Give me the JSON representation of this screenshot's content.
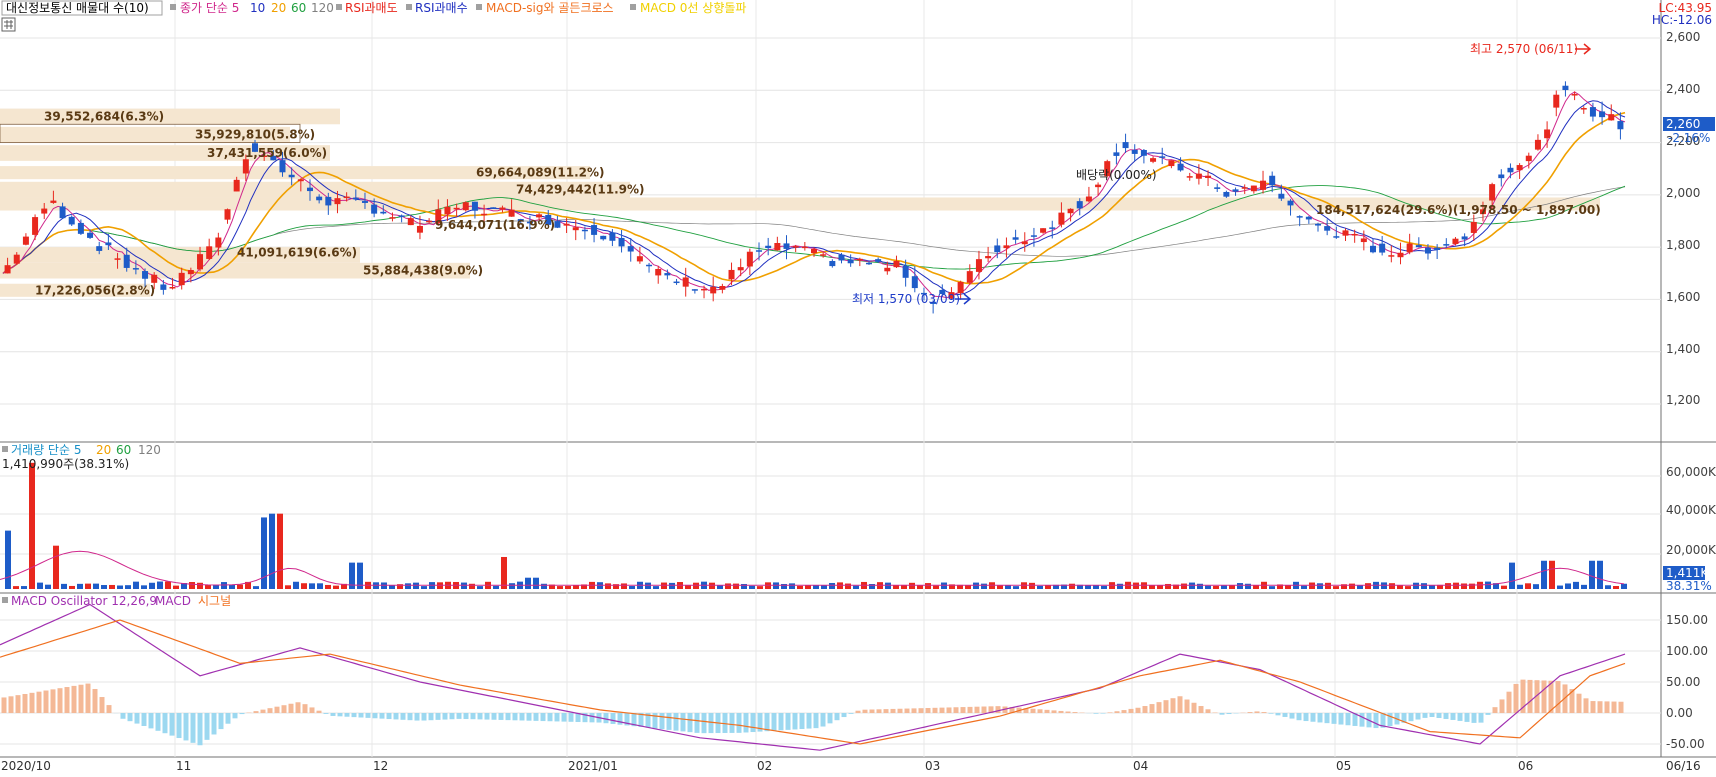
{
  "legend_top": {
    "title": "대신정보통신 매물대 수(10)",
    "ma_label": "종가 단순 5",
    "ma_periods": [
      "10",
      "20",
      "60",
      "120"
    ],
    "signals": [
      "RSI과매도",
      "RSI과매수",
      "MACD-sig와 골든크로스",
      "MACD 0선 상향돌파"
    ],
    "lc_value": "LC:43.95",
    "hc_value": "HC:-12.06"
  },
  "price_panel": {
    "y_ticks": [
      "2,600",
      "2,400",
      "2,200",
      "2,000",
      "1,800",
      "1,600",
      "1,400",
      "1,200"
    ],
    "current_price": "2,260",
    "current_change": "-2.16%",
    "high_label": "최고 2,570 (06/11)",
    "low_label": "최저 1,570 (03/09)",
    "dividend_label": "배당락(0.00%)",
    "volume_profile_labels": [
      "39,552,684(6.3%)",
      "35,929,810(5.8%)",
      "37,431,559(6.0%)",
      "69,664,089(11.2%)",
      "74,429,442(11.9%)",
      "41,091,619(6.6%)",
      "55,884,438(9.0%)",
      "17,226,056(2.8%)",
      "184,517,624(29.6%)(1,978.50 ~ 1,897.00)",
      "9,644,071(16.9%)"
    ]
  },
  "volume_panel": {
    "legend_label": "거래량 단순 5",
    "legend_periods": [
      "20",
      "60",
      "120"
    ],
    "last_volume": "1,410,990주(38.31%)",
    "y_ticks": [
      "60,000K",
      "40,000K",
      "20,000K"
    ],
    "current_volume": "1,411K",
    "current_ratio": "38.31%"
  },
  "macd_panel": {
    "legend_label": "MACD Oscillator 12,26,9",
    "legend_macd": "MACD",
    "legend_signal": "시그널",
    "y_ticks": [
      "150.00",
      "100.00",
      "50.00",
      "0.00",
      "-50.00"
    ]
  },
  "x_axis": {
    "labels": [
      "2020/10",
      "11",
      "12",
      "2021/01",
      "02",
      "03",
      "04",
      "05",
      "06",
      "06/16"
    ]
  },
  "colors": {
    "up": "#e8281e",
    "down": "#1e5cc8",
    "ma5": "#d0288c",
    "ma10": "#2030c0",
    "ma20": "#f0a000",
    "ma60": "#20a040",
    "ma120": "#808080",
    "macd": "#a030b0",
    "signal": "#f07020",
    "osc_pos": "#f4b896",
    "osc_neg": "#9cd8f0",
    "band": "#f5e6d0"
  },
  "chart_data": {
    "type": "candlestick",
    "period": "2020/10 ~ 2021/06/16",
    "price_range": [
      1100,
      2660
    ],
    "ohlc_sample": [
      {
        "date": "2020/10",
        "open": 1760,
        "high": 1830,
        "low": 1640,
        "close": 1690
      },
      {
        "date": "2020/11 (high)",
        "open": 2140,
        "high": 2320,
        "low": 2060,
        "close": 2100
      },
      {
        "date": "2021/01",
        "open": 1920,
        "high": 1980,
        "low": 1880,
        "close": 1900
      },
      {
        "date": "2021/03/09 (low)",
        "open": 1640,
        "high": 1680,
        "low": 1570,
        "close": 1600
      },
      {
        "date": "2021/04",
        "open": 2100,
        "high": 2230,
        "low": 2080,
        "close": 2220
      },
      {
        "date": "2021/06/11 (high)",
        "open": 2300,
        "high": 2570,
        "low": 2260,
        "close": 2400
      },
      {
        "date": "2021/06/16",
        "open": 2310,
        "high": 2330,
        "low": 2250,
        "close": 2260
      }
    ],
    "last_price": 2260,
    "volume_range_k": [
      0,
      70000
    ],
    "macd_range": [
      -70,
      180
    ]
  }
}
